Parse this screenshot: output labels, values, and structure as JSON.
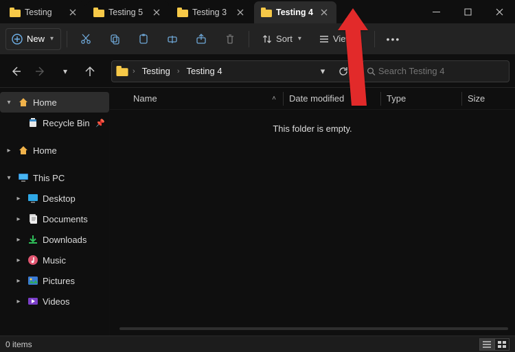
{
  "tabs": [
    {
      "label": "Testing"
    },
    {
      "label": "Testing 5"
    },
    {
      "label": "Testing 3"
    },
    {
      "label": "Testing 4",
      "active": true
    }
  ],
  "cmd": {
    "new": "New",
    "sort": "Sort",
    "view": "View"
  },
  "breadcrumbs": [
    "Testing",
    "Testing 4"
  ],
  "search": {
    "placeholder": "Search Testing 4"
  },
  "columns": {
    "name": "Name",
    "date": "Date modified",
    "type": "Type",
    "size": "Size"
  },
  "empty_text": "This folder is empty.",
  "tree": {
    "home": "Home",
    "recycle": "Recycle Bin",
    "home2": "Home",
    "thispc": "This PC",
    "desktop": "Desktop",
    "documents": "Documents",
    "downloads": "Downloads",
    "music": "Music",
    "pictures": "Pictures",
    "videos": "Videos"
  },
  "status": {
    "items": "0 items"
  }
}
